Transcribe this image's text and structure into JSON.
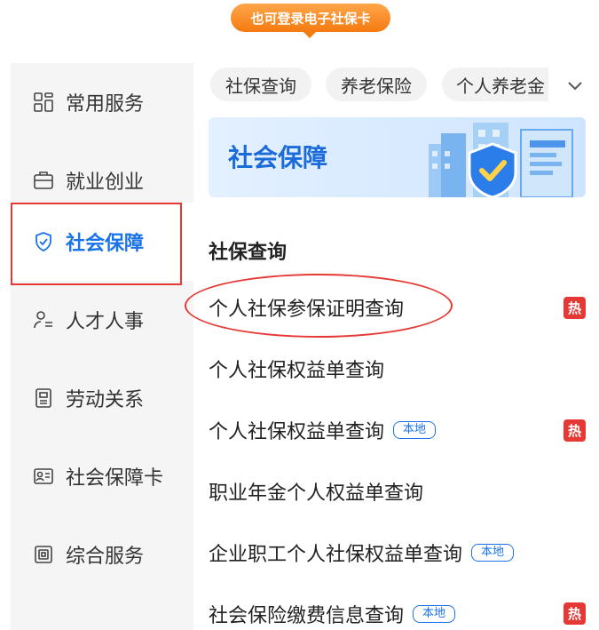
{
  "tooltip": {
    "text": "也可登录电子社保卡"
  },
  "sidebar": {
    "items": [
      {
        "label": "常用服务",
        "icon": "grid-icon"
      },
      {
        "label": "就业创业",
        "icon": "briefcase-icon"
      },
      {
        "label": "社会保障",
        "icon": "shield-check-icon",
        "active": true
      },
      {
        "label": "人才人事",
        "icon": "person-list-icon"
      },
      {
        "label": "劳动关系",
        "icon": "document-icon"
      },
      {
        "label": "社会保障卡",
        "icon": "id-card-icon"
      },
      {
        "label": "综合服务",
        "icon": "stack-icon"
      }
    ]
  },
  "tabs": {
    "items": [
      "社保查询",
      "养老保险",
      "个人养老金"
    ],
    "expand_icon": "chevron-down-icon"
  },
  "banner": {
    "title": "社会保障"
  },
  "section": {
    "title": "社保查询",
    "items": [
      {
        "label": "个人社保参保证明查询",
        "hot": "热"
      },
      {
        "label": "个人社保权益单查询"
      },
      {
        "label": "个人社保权益单查询",
        "local": "本地",
        "hot": "热"
      },
      {
        "label": "职业年金个人权益单查询"
      },
      {
        "label": "企业职工个人社保权益单查询",
        "local": "本地"
      },
      {
        "label": "社会保险缴费信息查询",
        "local": "本地",
        "hot": "热"
      }
    ]
  },
  "colors": {
    "accent": "#1a73e8",
    "hot": "#e53935",
    "tip": "#f57a10"
  }
}
